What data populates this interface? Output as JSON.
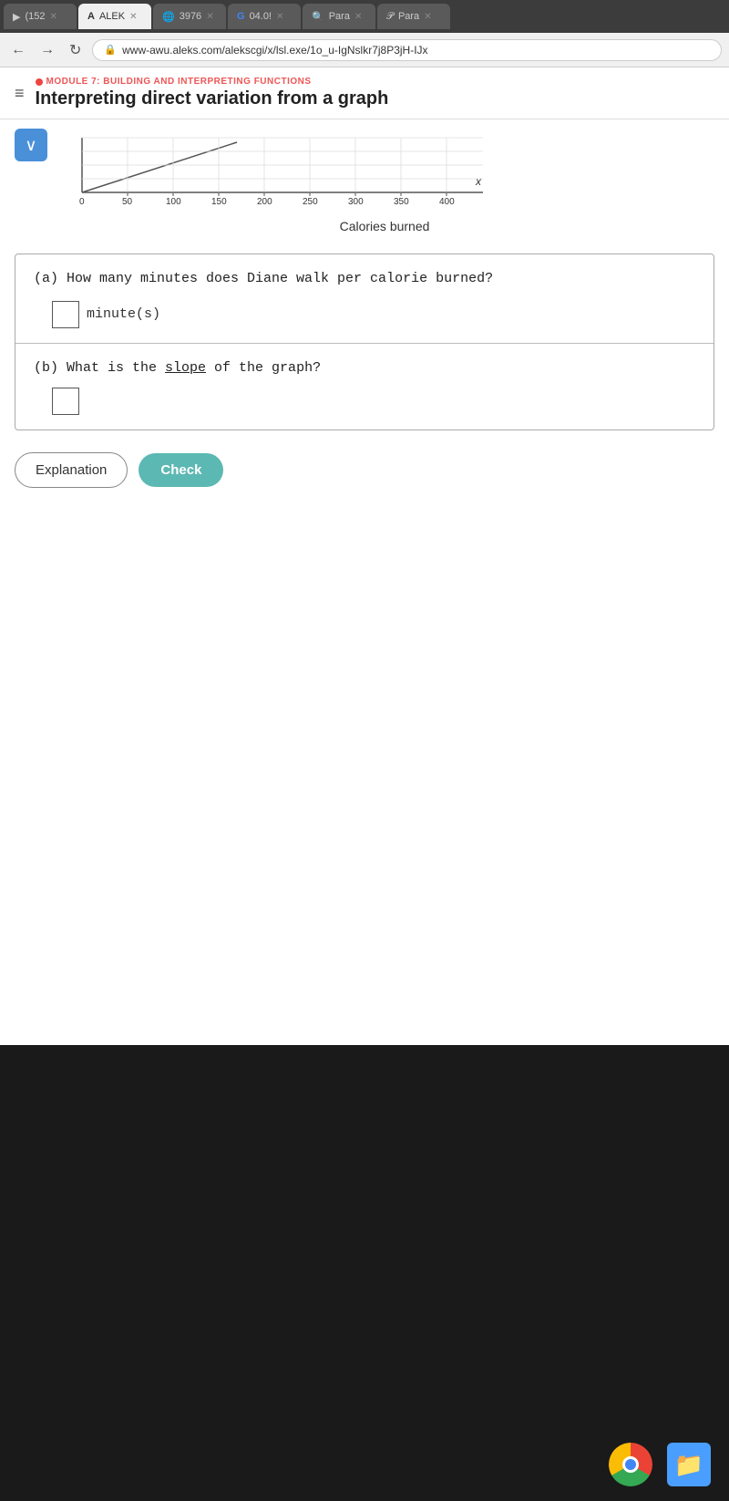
{
  "browser": {
    "tabs": [
      {
        "id": "tab1",
        "label": "(152",
        "icon": "▶",
        "active": false
      },
      {
        "id": "tab2",
        "label": "ALEK",
        "icon": "A",
        "active": true
      },
      {
        "id": "tab3",
        "label": "3976",
        "icon": "🌐",
        "active": false
      },
      {
        "id": "tab4",
        "label": "04.0!",
        "icon": "G",
        "active": false
      },
      {
        "id": "tab5",
        "label": "Para",
        "icon": "🔍",
        "active": false
      },
      {
        "id": "tab6",
        "label": "Para",
        "icon": "P",
        "active": false
      }
    ],
    "url": "www-awu.aleks.com/alekscgi/x/lsl.exe/1o_u-IgNslkr7j8P3jH-IJx"
  },
  "header": {
    "module_label": "MODULE 7: BUILDING AND INTERPRETING FUNCTIONS",
    "page_title": "Interpreting direct variation from a graph",
    "hamburger_label": "≡"
  },
  "graph": {
    "x_label": "x",
    "x_axis_values": [
      "0",
      "50",
      "100",
      "150",
      "200",
      "250",
      "300",
      "350",
      "400"
    ],
    "bottom_label": "Calories burned"
  },
  "questions": {
    "q_a_text": "(a) How many minutes does Diane walk per calorie burned?",
    "q_a_unit": "minute(s)",
    "q_b_text": "(b) What is the ",
    "q_b_link": "slope",
    "q_b_suffix": " of the graph?"
  },
  "buttons": {
    "explanation_label": "Explanation",
    "check_label": "Check"
  },
  "colors": {
    "accent": "#5cb8b2",
    "module_color": "#e44444",
    "expand_btn": "#4a90d9"
  }
}
